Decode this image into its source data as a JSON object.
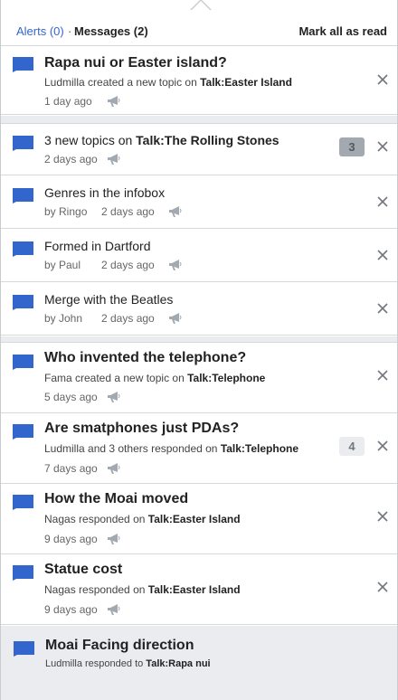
{
  "header": {
    "alerts_label": "Alerts (0)",
    "separator": "·",
    "messages_label": "Messages (2)",
    "mark_all_label": "Mark all as read"
  },
  "colors": {
    "accent": "#3366cc",
    "group_background": "#eaecf0",
    "divider": "#d6d9dc"
  },
  "icons": {
    "message": "speech-bubble-icon",
    "notice": "megaphone-icon",
    "dismiss": "close-icon"
  },
  "items": [
    {
      "title": "Rapa nui or Easter island?",
      "meta_pre": "Ludmilla created a new topic on ",
      "meta_bold": "Talk:Easter Island",
      "time": "1 day ago"
    },
    {
      "title_pre": "3 new topics on ",
      "title_bold": "Talk:The Rolling Stones",
      "time": "2 days ago",
      "badge": "3"
    },
    {
      "title": "Genres in the infobox",
      "by": "by Ringo",
      "time": "2 days ago"
    },
    {
      "title": "Formed in Dartford",
      "by": "by Paul",
      "time": "2 days ago"
    },
    {
      "title": "Merge with the Beatles",
      "by": "by John",
      "time": "2 days ago"
    },
    {
      "title": "Who invented the telephone?",
      "meta_pre": "Fama created a new topic on ",
      "meta_bold": "Talk:Telephone",
      "time": "5 days ago"
    },
    {
      "title": "Are smatphones just PDAs?",
      "meta_pre": "Ludmilla and 3 others responded on ",
      "meta_bold": "Talk:Telephone",
      "time": "7 days ago",
      "badge": "4"
    },
    {
      "title": "How the Moai moved",
      "meta_pre": "Nagas responded on ",
      "meta_bold": "Talk:Easter Island",
      "time": "9 days ago"
    },
    {
      "title": "Statue cost",
      "meta_pre": "Nagas responded on ",
      "meta_bold": "Talk:Easter Island",
      "time": "9 days ago"
    },
    {
      "title": "Moai Facing direction",
      "meta_pre": "Ludmilla responded to ",
      "meta_bold": "Talk:Rapa nui"
    }
  ]
}
